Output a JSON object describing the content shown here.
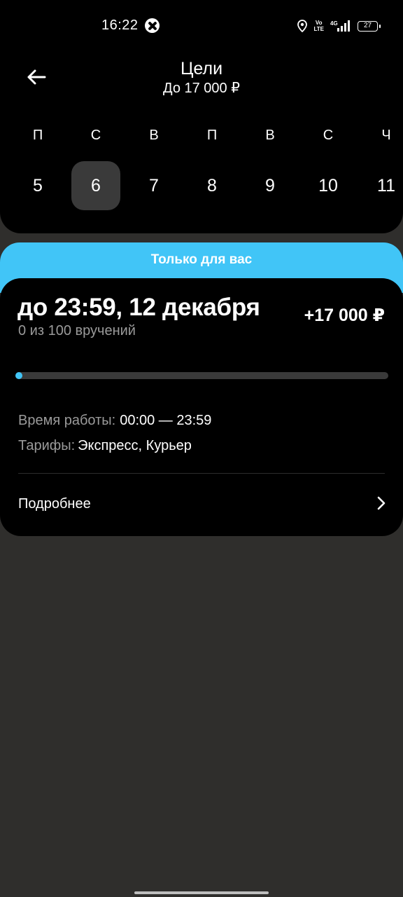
{
  "status_bar": {
    "time": "16:22",
    "volte_line1": "Vo",
    "volte_line2": "LTE",
    "network": "4G",
    "battery": "27"
  },
  "header": {
    "title": "Цели",
    "subtitle": "До 17 000 ₽",
    "days": [
      {
        "weekday": "П",
        "date": "5"
      },
      {
        "weekday": "С",
        "date": "6",
        "selected": true
      },
      {
        "weekday": "В",
        "date": "7"
      },
      {
        "weekday": "П",
        "date": "8"
      },
      {
        "weekday": "В",
        "date": "9"
      },
      {
        "weekday": "С",
        "date": "10"
      },
      {
        "weekday": "Ч",
        "date": "11"
      }
    ]
  },
  "promo": {
    "label": "Только для вас",
    "color": "#41c5f7"
  },
  "goal": {
    "deadline": "до 23:59, 12 декабря",
    "reward": "+17 000 ₽",
    "progress_text": "0 из 100 вручений",
    "progress_fraction": 0,
    "hours_label": "Время работы:",
    "hours_value": "00:00 — 23:59",
    "tariffs_label": "Тарифы:",
    "tariffs_value": "Экспресс, Курьер",
    "details_label": "Подробнее"
  },
  "icons": {
    "back": "arrow-left-icon",
    "details": "chevron-right-icon",
    "status": [
      "app-notification-icon",
      "location-icon",
      "volte-icon",
      "signal-icon",
      "battery-icon"
    ]
  }
}
